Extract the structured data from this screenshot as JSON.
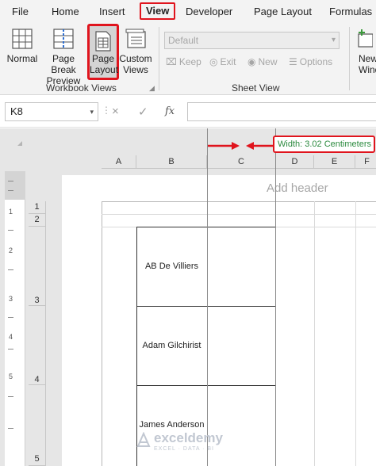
{
  "menubar": {
    "items": [
      {
        "label": "File",
        "active": false
      },
      {
        "label": "Home",
        "active": false
      },
      {
        "label": "Insert",
        "active": false
      },
      {
        "label": "View",
        "active": true
      },
      {
        "label": "Developer",
        "active": false
      },
      {
        "label": "Page Layout",
        "active": false
      },
      {
        "label": "Formulas",
        "active": false
      }
    ]
  },
  "ribbon": {
    "workbook_views": {
      "group_label": "Workbook Views",
      "buttons": [
        {
          "label": "Normal",
          "icon": "normal-view-icon"
        },
        {
          "label": "Page Break\nPreview",
          "icon": "page-break-preview-icon"
        },
        {
          "label": "Page\nLayout",
          "icon": "page-layout-icon",
          "selected": true
        },
        {
          "label": "Custom\nViews",
          "icon": "custom-views-icon"
        }
      ]
    },
    "sheet_view": {
      "group_label": "Sheet View",
      "select_value": "Default",
      "buttons": [
        {
          "label": "Keep",
          "icon": "keep-icon"
        },
        {
          "label": "Exit",
          "icon": "exit-icon"
        },
        {
          "label": "New",
          "icon": "new-view-icon"
        },
        {
          "label": "Options",
          "icon": "options-icon"
        }
      ]
    },
    "new_window": {
      "label": "New\nWindo",
      "icon": "new-window-icon"
    }
  },
  "formula_bar": {
    "name_box": "K8",
    "cancel_icon": "×",
    "enter_icon": "✓",
    "fx_label": "fx",
    "formula_value": ""
  },
  "sheet": {
    "columns": [
      "A",
      "B",
      "C",
      "D",
      "E",
      "F"
    ],
    "rows": [
      "1",
      "2",
      "3",
      "4",
      "5"
    ],
    "ruler_numbers": [
      "1",
      "2",
      "3",
      "4",
      "5"
    ],
    "add_header_text": "Add header",
    "width_tooltip": "Width: 3.02 Centimeters",
    "cells": [
      {
        "ref": "B3",
        "value": "AB De Villiers"
      },
      {
        "ref": "B4",
        "value": "Adam Gilchirist"
      },
      {
        "ref": "B5",
        "value": "James Anderson"
      }
    ]
  },
  "watermark": {
    "name": "exceldemy",
    "tagline": "EXCEL · DATA · BI"
  },
  "colors": {
    "highlight_red": "#e0141d",
    "tooltip_green": "#2b8a3e",
    "ribbon_bg": "#f3f3f3"
  }
}
